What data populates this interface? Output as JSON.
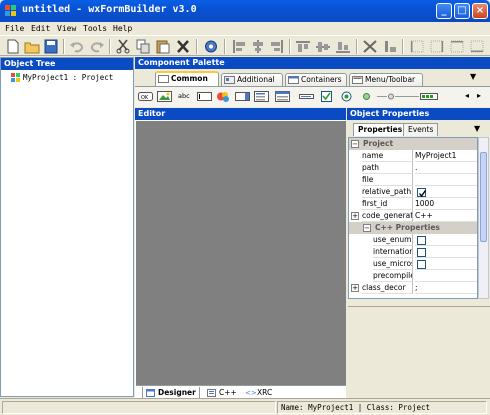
{
  "window": {
    "title": "untitled - wxFormBuilder v3.0",
    "btn_min": "_",
    "btn_max": "□",
    "btn_close": "×"
  },
  "menu": [
    "File",
    "Edit",
    "View",
    "Tools",
    "Help"
  ],
  "toolbar": [
    "new-icon",
    "open-icon",
    "save-icon",
    "undo-icon",
    "redo-icon",
    "cut-icon",
    "copy-icon",
    "paste-icon",
    "delete-icon",
    "settings-icon",
    "align-left-icon",
    "align-center-icon",
    "align-right-icon",
    "align-top-icon",
    "align-middle-icon",
    "align-bottom-icon",
    "expand-icon",
    "stretch-icon",
    "border-left-icon",
    "border-right-icon",
    "border-top-icon",
    "border-bottom-icon"
  ],
  "object_tree": {
    "header": "Object Tree",
    "root": "MyProject1 : Project"
  },
  "palette": {
    "header": "Component Palette",
    "tabs": [
      "Common",
      "Additional",
      "Containers",
      "Menu/Toolbar"
    ],
    "active_tab": "Common",
    "components": [
      {
        "icon": "button-icon",
        "text": "OK"
      },
      {
        "icon": "bitmap-button-icon",
        "text": ""
      },
      {
        "icon": "static-text-icon",
        "text": "abc"
      },
      {
        "icon": "text-ctrl-icon",
        "text": ""
      },
      {
        "icon": "combo-box-icon",
        "text": ""
      },
      {
        "icon": "choice-icon",
        "text": ""
      },
      {
        "icon": "list-box-icon",
        "text": ""
      },
      {
        "icon": "list-ctrl-icon",
        "text": ""
      },
      {
        "icon": "checkbox-icon",
        "text": ""
      },
      {
        "icon": "radio-button-icon",
        "text": ""
      },
      {
        "icon": "static-line-icon",
        "text": ""
      },
      {
        "icon": "slider-icon",
        "text": ""
      },
      {
        "icon": "gauge-icon",
        "text": ""
      }
    ]
  },
  "editor": {
    "header": "Editor",
    "tabs": [
      "Designer",
      "C++",
      "XRC"
    ],
    "active_tab": "Designer"
  },
  "properties": {
    "header": "Object Properties",
    "tabs": [
      "Properties",
      "Events"
    ],
    "active_tab": "Properties",
    "rows": [
      {
        "type": "category",
        "name": "Project",
        "expander": "⊟"
      },
      {
        "type": "prop",
        "name": "name",
        "value": "MyProject1"
      },
      {
        "type": "prop",
        "name": "path",
        "value": "."
      },
      {
        "type": "prop",
        "name": "file",
        "value": ""
      },
      {
        "type": "check",
        "name": "relative_path",
        "checked": true
      },
      {
        "type": "prop",
        "name": "first_id",
        "value": "1000"
      },
      {
        "type": "prop",
        "name": "code_generati",
        "value": "C++",
        "expander": "⊞"
      },
      {
        "type": "subcategory",
        "name": "C++ Properties",
        "expander": "⊟"
      },
      {
        "type": "check",
        "name": "use_enum",
        "checked": false,
        "indent": true
      },
      {
        "type": "check",
        "name": "internationa",
        "checked": false,
        "indent": true
      },
      {
        "type": "check",
        "name": "use_microso",
        "checked": false,
        "indent": true
      },
      {
        "type": "prop",
        "name": "precompiled",
        "value": "",
        "indent": true
      },
      {
        "type": "prop",
        "name": "class_decor",
        "value": ";",
        "expander": "⊞"
      }
    ]
  },
  "status": {
    "name": "Name: MyProject1 | Class: Project"
  },
  "colors": {
    "header_blue": "#0a4bc4",
    "title_blue": "#0853d4",
    "canvas_gray": "#808080",
    "face": "#ece9d8"
  }
}
